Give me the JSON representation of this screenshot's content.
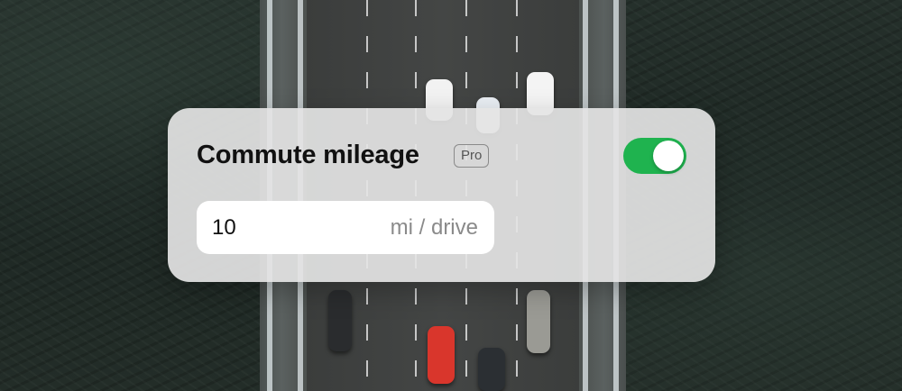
{
  "setting": {
    "title": "Commute mileage",
    "badge": "Pro",
    "toggle_on": true,
    "value": "10",
    "unit": "mi / drive"
  },
  "colors": {
    "toggle_on": "#1fb34f",
    "card_bg": "#e4e4e4",
    "input_bg": "#ffffff"
  },
  "icons": {
    "toggle": "toggle-switch-icon"
  }
}
